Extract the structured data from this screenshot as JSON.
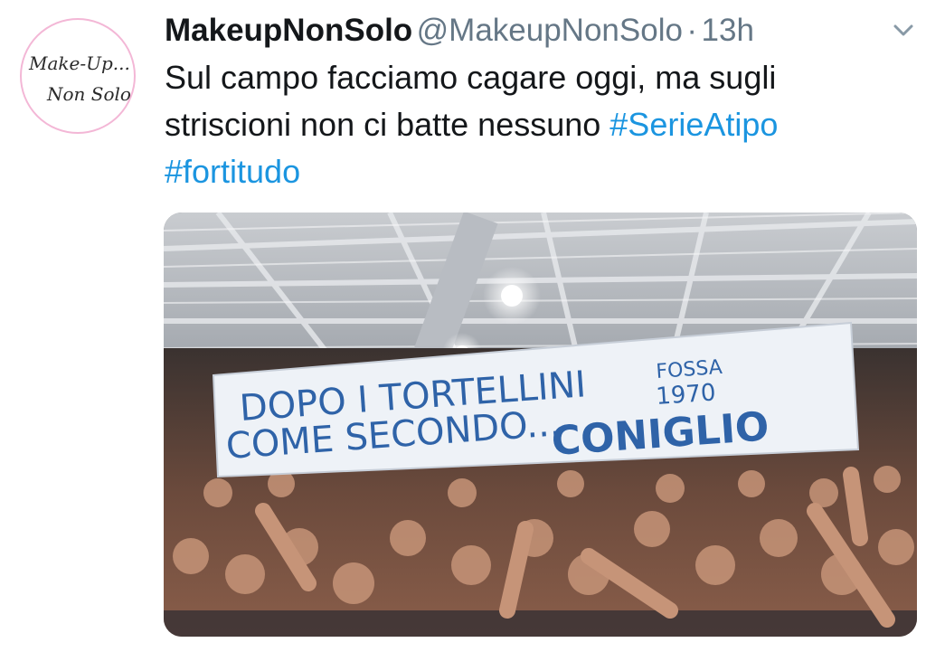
{
  "tweet": {
    "avatar": {
      "line1": "Make-Up...",
      "line2": "Non Solo"
    },
    "author_name": "MakeupNonSolo",
    "handle": "@MakeupNonSolo",
    "separator": "·",
    "time": "13h",
    "menu_icon": "chevron-down-icon",
    "text": "Sul campo facciamo cagare oggi, ma sugli striscioni non ci batte nessuno ",
    "hashtags": [
      "#SerieAtipo",
      "#fortitudo"
    ],
    "link_color": "#1b95e0"
  },
  "media": {
    "banner": {
      "line1": "DOPO I TORTELLINI",
      "line2": "COME SECONDO...",
      "highlight": "CONIGLIO",
      "stamp_top": "FOSSA",
      "stamp_year": "1970"
    }
  }
}
